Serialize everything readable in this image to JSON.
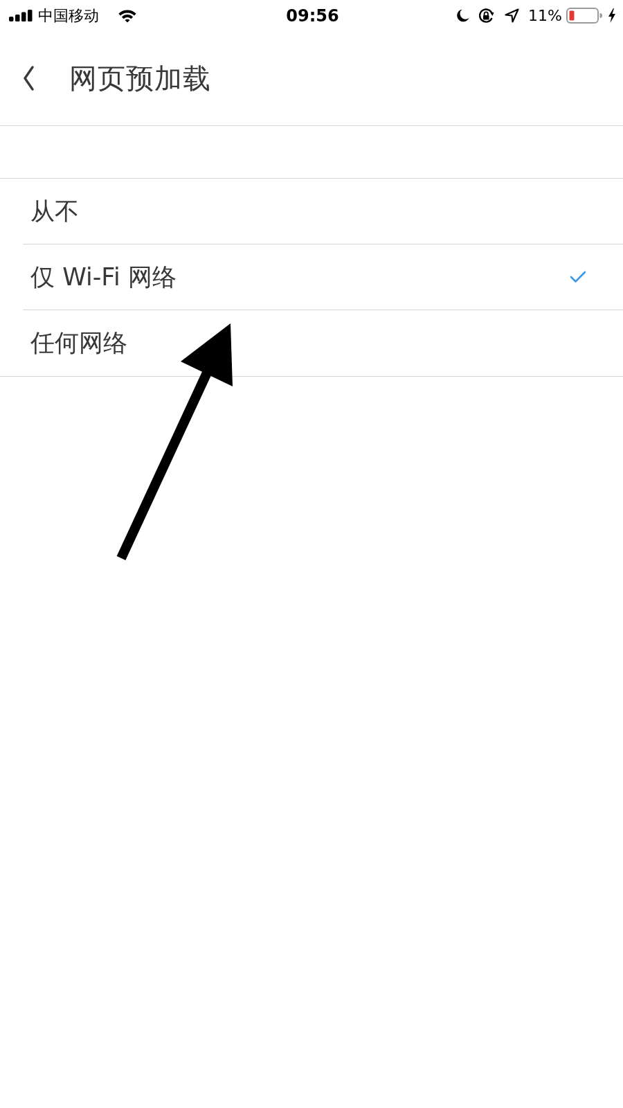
{
  "status_bar": {
    "carrier": "中国移动",
    "time": "09:56",
    "battery_percent": "11%"
  },
  "header": {
    "title": "网页预加载"
  },
  "options": [
    {
      "label": "从不",
      "selected": false
    },
    {
      "label": "仅 Wi-Fi 网络",
      "selected": true
    },
    {
      "label": "任何网络",
      "selected": false
    }
  ]
}
